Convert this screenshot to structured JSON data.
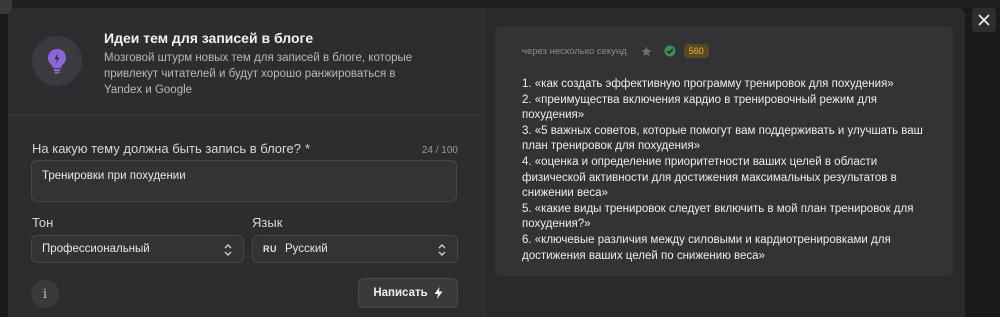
{
  "tool": {
    "title": "Идеи тем для записей в блоге",
    "description": "Мозговой штурм новых тем для записей в блоге, которые привлекут читателей и будут хорошо ранжироваться в Yandex и Google",
    "icon": "lightbulb-icon"
  },
  "form": {
    "question_label": "На какую тему должна быть запись в блоге?",
    "required_mark": "*",
    "counter": "24 / 100",
    "topic_value": "Тренировки при похудении",
    "tone_label": "Тон",
    "tone_value": "Профессиональный",
    "language_label": "Язык",
    "language_flag": "RU",
    "language_value": "Русский",
    "info_glyph": "i",
    "write_label": "Написать"
  },
  "result": {
    "timestamp": "через несколько секунд",
    "tokens": "560",
    "lines": [
      "1. «как создать эффективную программу тренировок для похудения»",
      "2. «преимущества включения кардио в тренировочный режим для похудения»",
      "3. «5 важных советов, которые помогут вам поддерживать и улучшать ваш план тренировок для похудения»",
      "4. «оценка и определение приоритетности ваших целей в области физической активности для достижения максимальных результатов в снижении веса»",
      "5. «какие виды тренировок следует включить в мой план тренировок для похудения?»",
      "6. «ключевые различия между силовыми и кардиотренировками для достижения ваших целей по снижению веса»"
    ]
  },
  "colors": {
    "background": "#1a1a1c",
    "panel": "#2d2d2f",
    "card": "#333335",
    "accent_purple": "#9b7bd8",
    "success_green": "#4caf6a",
    "token_badge": "#e6b54a"
  }
}
